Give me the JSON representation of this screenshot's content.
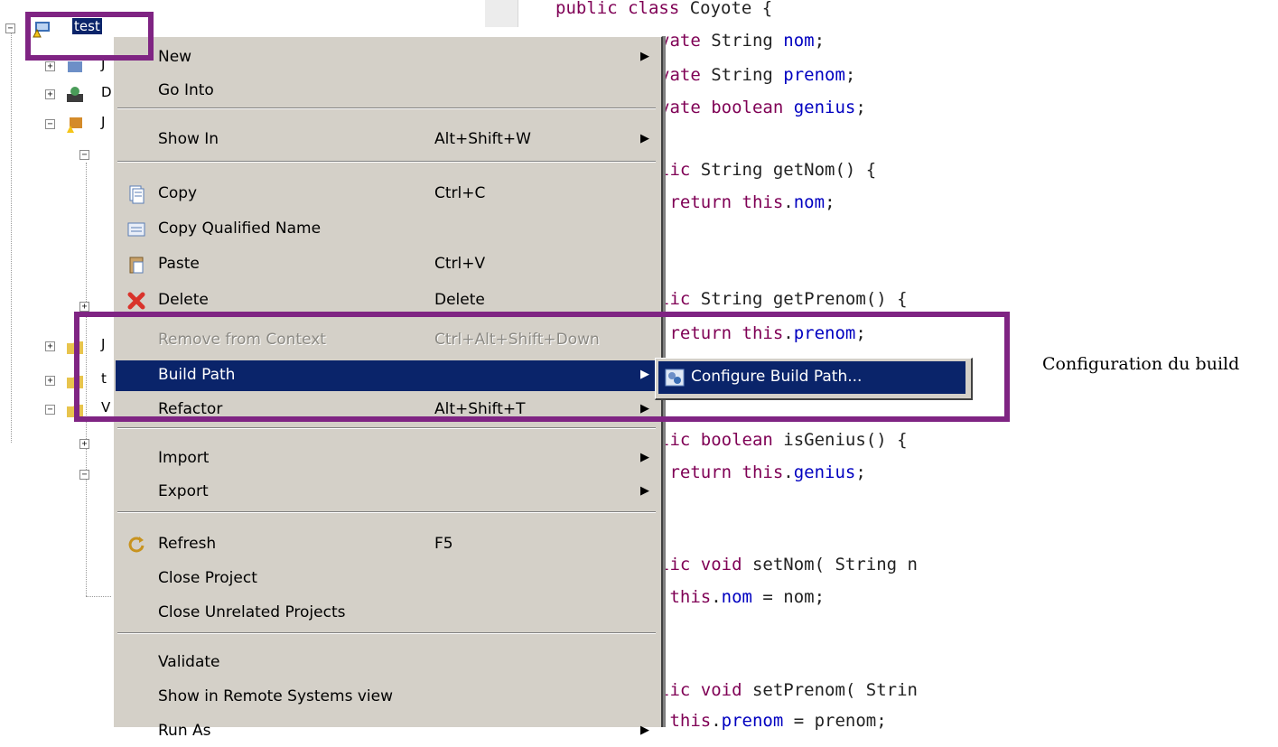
{
  "tree": {
    "project_name": "test",
    "row_fragments": [
      "J",
      "D",
      "J",
      "J",
      "t",
      "V"
    ]
  },
  "editor": {
    "lines": [
      {
        "parts": [
          [
            "kw",
            "public class"
          ],
          [
            "",
            " Coyote {"
          ]
        ]
      },
      {
        "parts": [
          [
            "kw",
            "vate"
          ],
          [
            "",
            " String "
          ],
          [
            "fld",
            "nom"
          ],
          [
            "",
            ";"
          ]
        ]
      },
      {
        "parts": [
          [
            "kw",
            "vate"
          ],
          [
            "",
            " String "
          ],
          [
            "fld",
            "prenom"
          ],
          [
            "",
            ";"
          ]
        ]
      },
      {
        "parts": [
          [
            "kw",
            "vate boolean"
          ],
          [
            "fld",
            " genius"
          ],
          [
            "",
            ";"
          ]
        ]
      },
      {
        "parts": [
          [
            "kw",
            "lic"
          ],
          [
            "",
            " String getNom() {"
          ]
        ]
      },
      {
        "parts": [
          [
            "kw",
            " return this"
          ],
          [
            "",
            "."
          ],
          [
            "fld",
            "nom"
          ],
          [
            "",
            ";"
          ]
        ]
      },
      {
        "parts": [
          [
            "kw",
            "lic"
          ],
          [
            "",
            " String getPrenom() {"
          ]
        ]
      },
      {
        "parts": [
          [
            "kw",
            " return this"
          ],
          [
            "",
            "."
          ],
          [
            "fld",
            "prenom"
          ],
          [
            "",
            ";"
          ]
        ]
      },
      {
        "parts": [
          [
            "kw",
            "lic boolean"
          ],
          [
            "",
            " isGenius() {"
          ]
        ]
      },
      {
        "parts": [
          [
            "kw",
            " return this"
          ],
          [
            "",
            "."
          ],
          [
            "fld",
            "genius"
          ],
          [
            "",
            ";"
          ]
        ]
      },
      {
        "parts": [
          [
            "kw",
            "lic void"
          ],
          [
            "",
            " setNom( String n"
          ]
        ]
      },
      {
        "parts": [
          [
            "kw",
            " this"
          ],
          [
            "",
            "."
          ],
          [
            "fld",
            "nom"
          ],
          [
            "",
            " = nom;"
          ]
        ]
      },
      {
        "parts": [
          [
            "kw",
            "lic void"
          ],
          [
            "",
            " setPrenom( Strin"
          ]
        ]
      },
      {
        "parts": [
          [
            "kw",
            " this"
          ],
          [
            "",
            "."
          ],
          [
            "fld",
            "prenom"
          ],
          [
            "",
            " = prenom;"
          ]
        ]
      }
    ]
  },
  "menu": {
    "items": [
      {
        "label": "New",
        "shortcut": "",
        "submenu": true
      },
      {
        "label": "Go Into",
        "shortcut": "",
        "submenu": false
      },
      {
        "label": "Show In",
        "shortcut": "Alt+Shift+W",
        "submenu": true
      },
      {
        "label": "Copy",
        "shortcut": "Ctrl+C",
        "submenu": false,
        "icon": "copy-icon"
      },
      {
        "label": "Copy Qualified Name",
        "shortcut": "",
        "submenu": false,
        "icon": "copy-qualified-name-icon"
      },
      {
        "label": "Paste",
        "shortcut": "Ctrl+V",
        "submenu": false,
        "icon": "paste-icon"
      },
      {
        "label": "Delete",
        "shortcut": "Delete",
        "submenu": false,
        "icon": "delete-icon"
      },
      {
        "label": "Remove from Context",
        "shortcut": "Ctrl+Alt+Shift+Down",
        "submenu": false,
        "disabled": true
      },
      {
        "label": "Build Path",
        "shortcut": "",
        "submenu": true,
        "selected": true
      },
      {
        "label": "Refactor",
        "shortcut": "Alt+Shift+T",
        "submenu": true
      },
      {
        "label": "Import",
        "shortcut": "",
        "submenu": true
      },
      {
        "label": "Export",
        "shortcut": "",
        "submenu": true
      },
      {
        "label": "Refresh",
        "shortcut": "F5",
        "submenu": false,
        "icon": "refresh-icon"
      },
      {
        "label": "Close Project",
        "shortcut": "",
        "submenu": false
      },
      {
        "label": "Close Unrelated Projects",
        "shortcut": "",
        "submenu": false
      },
      {
        "label": "Validate",
        "shortcut": "",
        "submenu": false
      },
      {
        "label": "Show in Remote Systems view",
        "shortcut": "",
        "submenu": false
      },
      {
        "label": "Run As",
        "shortcut": "",
        "submenu": true
      }
    ]
  },
  "submenu": {
    "item_label": "Configure Build Path...",
    "icon": "build-path-icon"
  },
  "annotation": {
    "text": "Configuration du build",
    "highlight_color": "#7f2483"
  },
  "colors": {
    "menu_bg": "#d4d0c8",
    "selection": "#0a246a",
    "keyword": "#7f0055",
    "field": "#0000c0"
  }
}
